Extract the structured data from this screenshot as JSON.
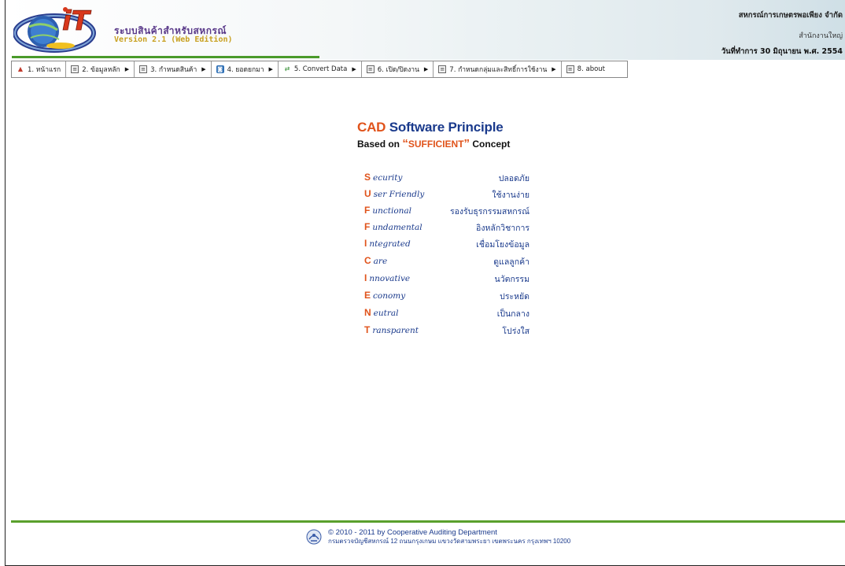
{
  "header": {
    "system_title": "ระบบสินค้าสำหรับสหกรณ์",
    "version": "Version 2.1 (Web Edition)",
    "organization": "สหกรณ์การเกษตรพอเพียง จำกัด",
    "branch": "สำนักงานใหญ่",
    "work_date": "วันที่ทำการ 30 มิถุนายน พ.ศ. 2554",
    "logo_text": "iT"
  },
  "menu": {
    "items": [
      {
        "label": "1. หน้าแรก",
        "icon": "home-icon",
        "has_submenu": false
      },
      {
        "label": "2. ข้อมูลหลัก",
        "icon": "document-icon",
        "has_submenu": true
      },
      {
        "label": "3. กำหนดสินค้า",
        "icon": "document-icon",
        "has_submenu": true
      },
      {
        "label": "4. ยอดยกมา",
        "icon": "database-icon",
        "has_submenu": true
      },
      {
        "label": "5. Convert Data",
        "icon": "convert-icon",
        "has_submenu": true
      },
      {
        "label": "6. เปิด/ปิดงาน",
        "icon": "document-icon",
        "has_submenu": true
      },
      {
        "label": "7. กำหนดกลุ่มและสิทธิ์การใช้งาน",
        "icon": "document-icon",
        "has_submenu": true
      },
      {
        "label": "8. about",
        "icon": "document-icon",
        "has_submenu": false
      }
    ]
  },
  "principle": {
    "title_cad": "CAD",
    "title_rest": "Software Principle",
    "subtitle_before": "Based on",
    "subtitle_keyword": "SUFFICIENT",
    "subtitle_after": "Concept",
    "rows": [
      {
        "cap": "S",
        "rest": "ecurity",
        "th": "ปลอดภัย"
      },
      {
        "cap": "U",
        "rest": "ser Friendly",
        "th": "ใช้งานง่าย"
      },
      {
        "cap": "F",
        "rest": "unctional",
        "th": "รองรับธุรกรรมสหกรณ์"
      },
      {
        "cap": "F",
        "rest": "undamental",
        "th": "อิงหลักวิชาการ"
      },
      {
        "cap": "I",
        "rest": "ntegrated",
        "th": "เชื่อมโยงข้อมูล"
      },
      {
        "cap": "C",
        "rest": "are",
        "th": "ดูแลลูกค้า"
      },
      {
        "cap": "I",
        "rest": "nnovative",
        "th": "นวัตกรรม"
      },
      {
        "cap": "E",
        "rest": "conomy",
        "th": "ประหยัด"
      },
      {
        "cap": "N",
        "rest": "eutral",
        "th": "เป็นกลาง"
      },
      {
        "cap": "T",
        "rest": "ransparent",
        "th": "โปร่งใส"
      }
    ]
  },
  "footer": {
    "copyright": "© 2010 - 2011  by Cooperative Auditing Department",
    "address": "กรมตรวจบัญชีสหกรณ์ 12 ถนนกรุงเกษม แขวงวัดสามพระยา เขตพระนคร กรุงเทพฯ 10200"
  },
  "colors": {
    "accent_orange": "#e0531b",
    "navy": "#1a3a8c",
    "green": "#5aa02c"
  }
}
